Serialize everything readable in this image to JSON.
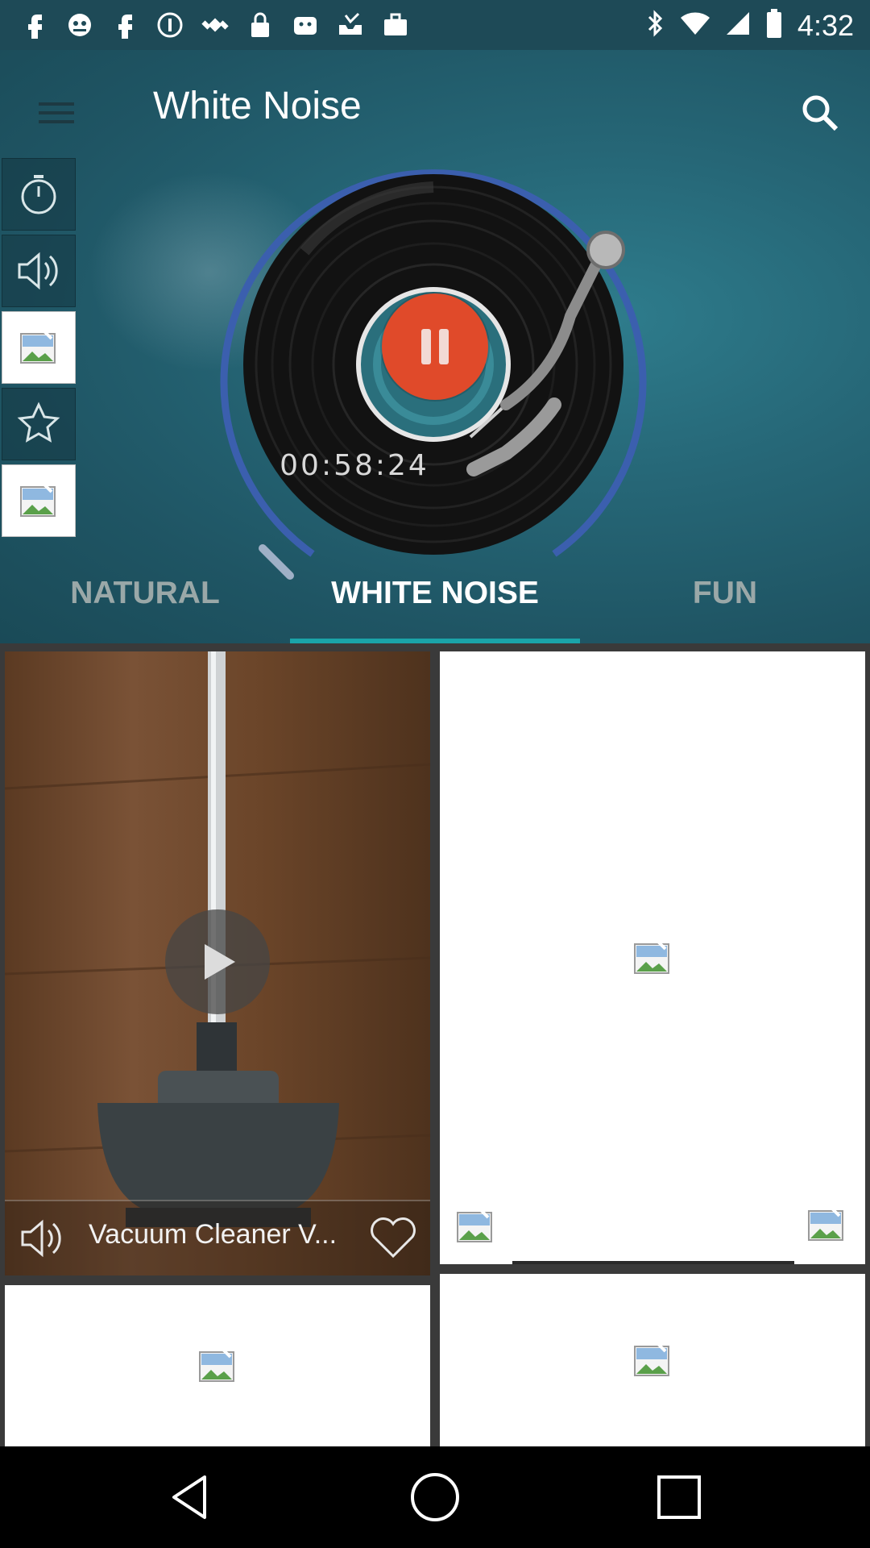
{
  "status_bar": {
    "time": "4:32",
    "icons": [
      "fb-icon",
      "fake-app-icon",
      "fb-icon",
      "notification-icon",
      "satellite-icon",
      "lock-icon",
      "app-icon",
      "inbox-icon",
      "briefcase-icon"
    ]
  },
  "header": {
    "title": "White Noise"
  },
  "player": {
    "elapsed": "00:58:24",
    "state": "playing",
    "progress_fraction": 0.84
  },
  "side_buttons": [
    "timer-icon",
    "volume-icon",
    "image-icon",
    "star-icon",
    "image-icon"
  ],
  "tabs": [
    {
      "label": "NATURAL",
      "active": false
    },
    {
      "label": "WHITE NOISE",
      "active": true
    },
    {
      "label": "FUN",
      "active": false
    }
  ],
  "sounds": [
    {
      "title": "Vacuum Cleaner V...",
      "has_image": true
    }
  ],
  "colors": {
    "accent": "#1aa3a8",
    "pause_button": "#e04a2a",
    "arc": "#3b5fae"
  }
}
